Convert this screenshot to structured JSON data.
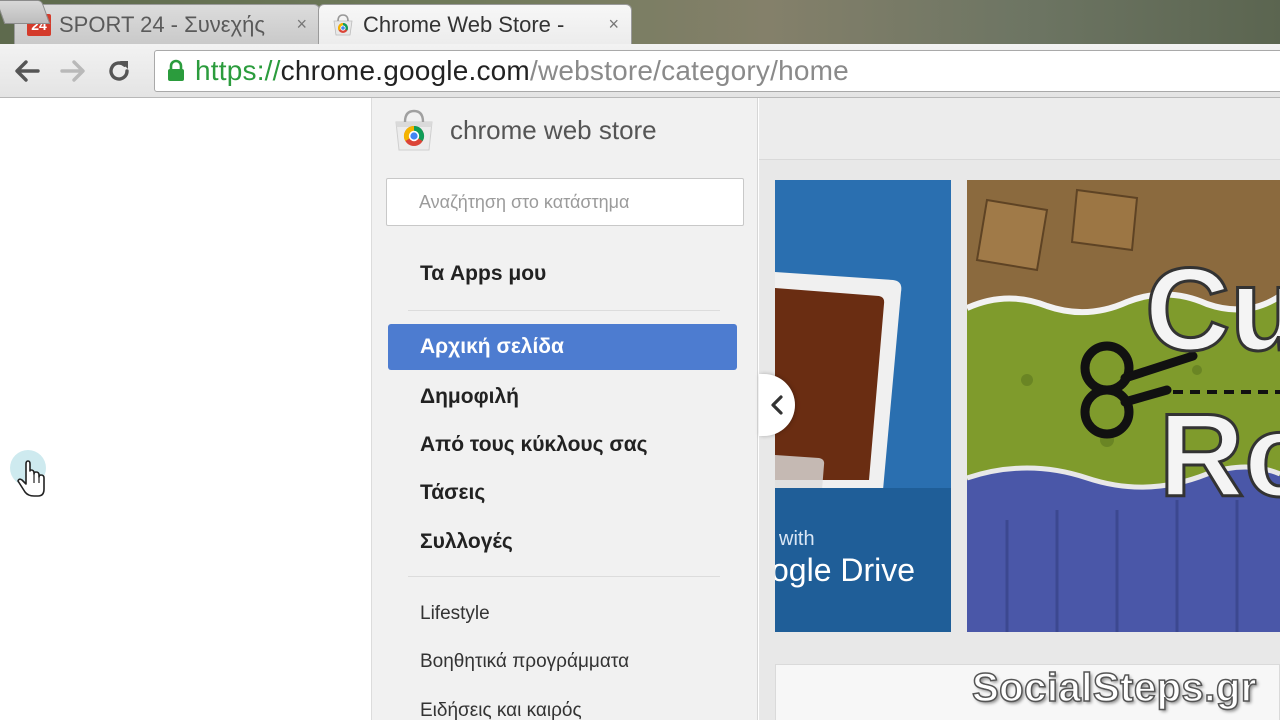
{
  "browser": {
    "tabs": [
      {
        "favicon_text": "24",
        "title": "SPORT 24 - Συνεχής",
        "close": "×"
      },
      {
        "title": "Chrome Web Store - ",
        "close": "×"
      }
    ],
    "url": {
      "scheme": "https://",
      "host": "chrome.google.com",
      "path": "/webstore/category/home"
    }
  },
  "store": {
    "name": "chrome web store",
    "search_placeholder": "Αναζήτηση στο κατάστημα",
    "my_apps": "Τα Apps μου",
    "nav": [
      {
        "label": "Αρχική σελίδα",
        "active": true
      },
      {
        "label": "Δημοφιλή"
      },
      {
        "label": "Από τους κύκλους σας"
      },
      {
        "label": "Τάσεις"
      },
      {
        "label": "Συλλογές"
      }
    ],
    "categories": [
      "Lifestyle",
      "Βοηθητικά προγράμματα",
      "Ειδήσεις και καιρός"
    ]
  },
  "featured": {
    "drive_promo_small": "with",
    "drive_promo_big": "ogle Drive",
    "game_title_fragment_top": "Cu",
    "game_title_fragment_bottom": "Ro"
  },
  "watermark": "SocialSteps.gr",
  "colors": {
    "active_nav": "#4d7cd0",
    "url_scheme": "#2b9c3d",
    "drive_tile": "#2a6fb0"
  }
}
